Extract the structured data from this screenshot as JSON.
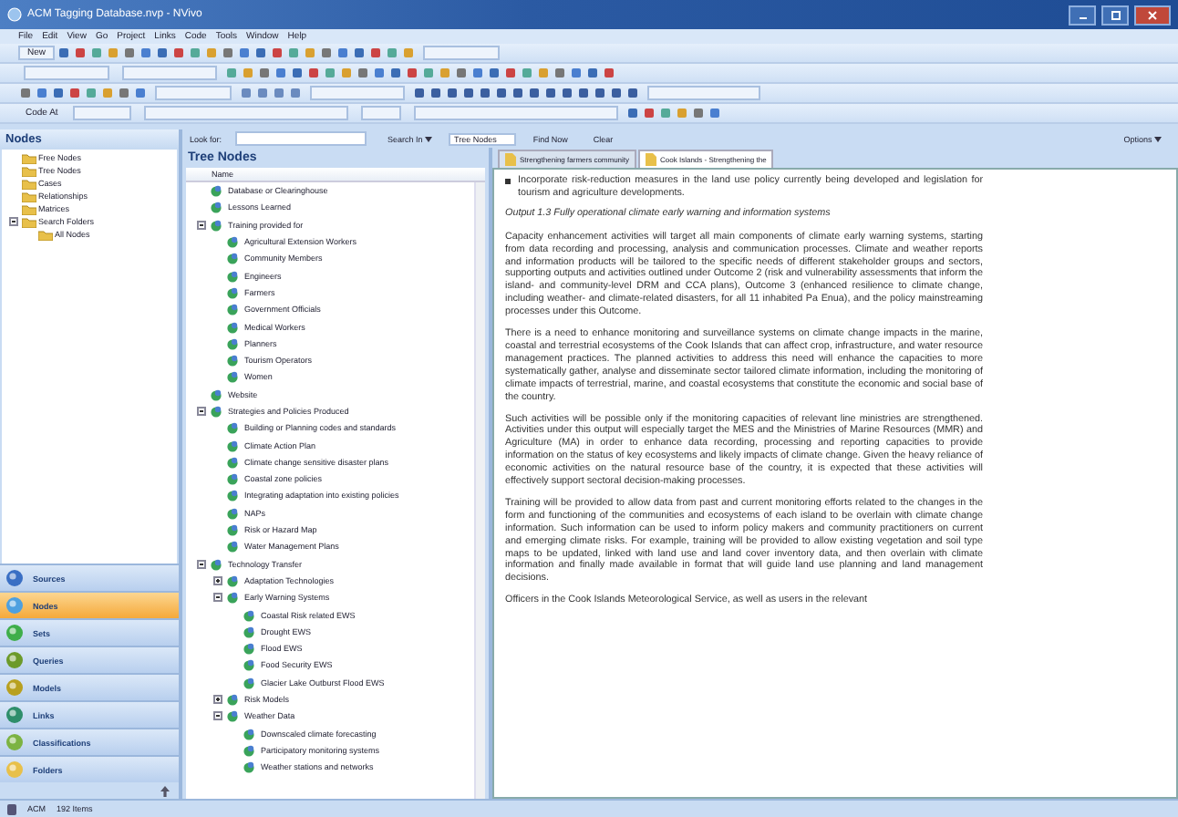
{
  "window": {
    "title": "ACM Tagging Database.nvp - NVivo"
  },
  "menu": [
    "File",
    "Edit",
    "View",
    "Go",
    "Project",
    "Links",
    "Code",
    "Tools",
    "Window",
    "Help"
  ],
  "toolbar": {
    "new_label": "New",
    "code_at_label": "Code At"
  },
  "find_bar": {
    "look_for_label": "Look for:",
    "search_in": "Search In",
    "scope": "Tree Nodes",
    "find_now": "Find Now",
    "clear": "Clear",
    "options": "Options"
  },
  "navigation": {
    "title": "Nodes",
    "folders": [
      {
        "label": "Free Nodes"
      },
      {
        "label": "Tree Nodes"
      },
      {
        "label": "Cases"
      },
      {
        "label": "Relationships"
      },
      {
        "label": "Matrices"
      },
      {
        "label": "Search Folders",
        "expanded": true,
        "children": [
          {
            "label": "All Nodes"
          }
        ]
      }
    ],
    "buttons": [
      {
        "label": "Sources",
        "selected": false
      },
      {
        "label": "Nodes",
        "selected": true
      },
      {
        "label": "Sets",
        "selected": false
      },
      {
        "label": "Queries",
        "selected": false
      },
      {
        "label": "Models",
        "selected": false
      },
      {
        "label": "Links",
        "selected": false
      },
      {
        "label": "Classifications",
        "selected": false
      },
      {
        "label": "Folders",
        "selected": false
      }
    ]
  },
  "tree": {
    "title": "Tree Nodes",
    "column": "Name",
    "nodes": [
      {
        "label": "Database or Clearinghouse"
      },
      {
        "label": "Lessons Learned"
      },
      {
        "label": "Training provided for",
        "expanded": true,
        "children": [
          {
            "label": "Agricultural Extension Workers"
          },
          {
            "label": "Community Members"
          },
          {
            "label": "Engineers"
          },
          {
            "label": "Farmers"
          },
          {
            "label": "Government Officials"
          },
          {
            "label": "Medical Workers"
          },
          {
            "label": "Planners"
          },
          {
            "label": "Tourism Operators"
          },
          {
            "label": "Women"
          }
        ]
      },
      {
        "label": "Website"
      },
      {
        "label": "Strategies and Policies Produced",
        "expanded": true,
        "children": [
          {
            "label": "Building or Planning codes and standards"
          },
          {
            "label": "Climate Action Plan"
          },
          {
            "label": "Climate change sensitive disaster plans"
          },
          {
            "label": "Coastal zone policies"
          },
          {
            "label": "Integrating adaptation into existing policies"
          },
          {
            "label": "NAPs"
          },
          {
            "label": "Risk or Hazard Map"
          },
          {
            "label": "Water Management Plans"
          }
        ]
      },
      {
        "label": "Technology Transfer",
        "expanded": true,
        "children": [
          {
            "label": "Adaptation Technologies",
            "expanded": false
          },
          {
            "label": "Early Warning Systems",
            "expanded": true,
            "children": [
              {
                "label": "Coastal Risk related EWS"
              },
              {
                "label": "Drought EWS"
              },
              {
                "label": "Flood EWS"
              },
              {
                "label": "Food Security EWS"
              },
              {
                "label": "Glacier Lake Outburst Flood EWS"
              }
            ]
          },
          {
            "label": "Risk Models",
            "expanded": false
          },
          {
            "label": "Weather Data",
            "expanded": true,
            "children": [
              {
                "label": "Downscaled climate forecasting"
              },
              {
                "label": "Participatory monitoring systems"
              },
              {
                "label": "Weather stations and networks"
              }
            ]
          }
        ]
      }
    ]
  },
  "document": {
    "tabs": [
      {
        "label": "Strengthening farmers community",
        "selected": false
      },
      {
        "label": "Cook Islands - Strengthening the",
        "selected": true
      }
    ],
    "blocks": [
      {
        "kind": "bullet",
        "text": "Incorporate risk-reduction measures in the land use policy currently being developed and legislation for tourism and agriculture developments."
      },
      {
        "kind": "heading",
        "text": "Output 1.3 Fully operational climate early warning and information systems"
      },
      {
        "kind": "paragraph",
        "text": "Capacity enhancement activities will target all main components of climate early warning systems, starting from data recording and processing, analysis and communication processes. Climate and weather reports and information products will be tailored to the specific needs of different stakeholder groups and sectors, supporting outputs and activities outlined under Outcome 2 (risk and vulnerability assessments that inform the island- and community-level DRM and CCA plans), Outcome 3 (enhanced resilience to climate change, including weather- and climate-related disasters, for all 11 inhabited Pa Enua), and the policy mainstreaming processes under this Outcome."
      },
      {
        "kind": "paragraph",
        "text": "There is a need to enhance monitoring and surveillance systems on climate change impacts in the marine, coastal and terrestrial ecosystems of the Cook Islands that can affect crop, infrastructure, and water resource management practices. The planned activities to address this need will enhance the capacities to more systematically gather, analyse and disseminate sector tailored climate information, including the monitoring of climate impacts of terrestrial, marine, and coastal ecosystems that constitute the economic and social base of the country."
      },
      {
        "kind": "paragraph",
        "text": "Such activities will be possible only if the monitoring capacities of relevant line ministries are strengthened. Activities under this output will especially target the MES and the Ministries of Marine Resources (MMR) and Agriculture (MA) in order to enhance data recording, processing and reporting capacities to provide information on the status of key ecosystems and likely impacts of climate change. Given the heavy reliance of economic activities on the natural resource base of the country, it is expected that these activities will effectively support sectoral decision-making processes."
      },
      {
        "kind": "paragraph",
        "text": "Training will be provided to allow data from past and current monitoring efforts related to the changes in the form and functioning of the communities and ecosystems of each island to be overlain with climate change information. Such information can be used to inform policy makers and community practitioners on current and emerging climate risks. For example, training will be provided to allow existing vegetation and soil type maps to be updated, linked with land use and land cover inventory data, and then overlain with climate information and finally made available in format that will guide land use planning and land management decisions."
      },
      {
        "kind": "paragraph",
        "text": "Officers in the Cook Islands Meteorological Service, as well as users in the relevant"
      }
    ]
  },
  "status_bar": {
    "project": "ACM",
    "count": "192 Items"
  }
}
